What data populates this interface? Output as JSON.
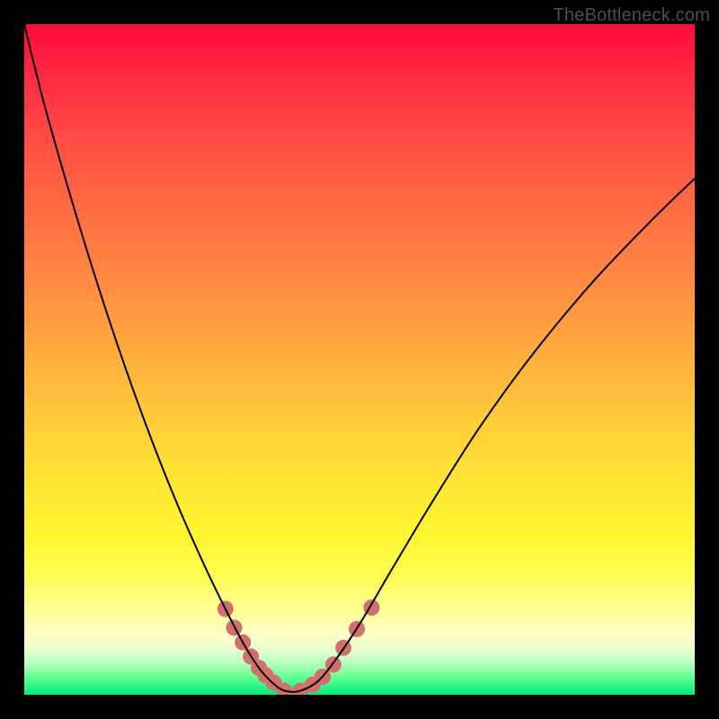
{
  "watermark": "TheBottleneck.com",
  "chart_data": {
    "type": "line",
    "title": "",
    "xlabel": "",
    "ylabel": "",
    "xlim": [
      0,
      1
    ],
    "ylim": [
      0,
      1
    ],
    "series": [
      {
        "name": "black-curve",
        "color": "#000000",
        "stroke_width": 2,
        "x": [
          0.0,
          0.03,
          0.07,
          0.11,
          0.15,
          0.19,
          0.23,
          0.27,
          0.3,
          0.326,
          0.35,
          0.37,
          0.388,
          0.412,
          0.44,
          0.47,
          0.503,
          0.55,
          0.61,
          0.68,
          0.76,
          0.85,
          0.94,
          1.0
        ],
        "y": [
          1.0,
          0.88,
          0.74,
          0.61,
          0.49,
          0.38,
          0.28,
          0.19,
          0.128,
          0.078,
          0.04,
          0.018,
          0.006,
          0.006,
          0.022,
          0.06,
          0.11,
          0.19,
          0.29,
          0.4,
          0.51,
          0.618,
          0.712,
          0.77
        ]
      },
      {
        "name": "pink-markers",
        "color": "#d36f6f",
        "marker_radius": 9,
        "x": [
          0.3,
          0.313,
          0.326,
          0.338,
          0.35,
          0.36,
          0.372,
          0.388,
          0.412,
          0.43,
          0.445,
          0.461,
          0.476,
          0.496,
          0.518
        ],
        "y": [
          0.128,
          0.1,
          0.078,
          0.057,
          0.04,
          0.029,
          0.018,
          0.006,
          0.006,
          0.015,
          0.027,
          0.045,
          0.07,
          0.098,
          0.13
        ]
      }
    ]
  }
}
